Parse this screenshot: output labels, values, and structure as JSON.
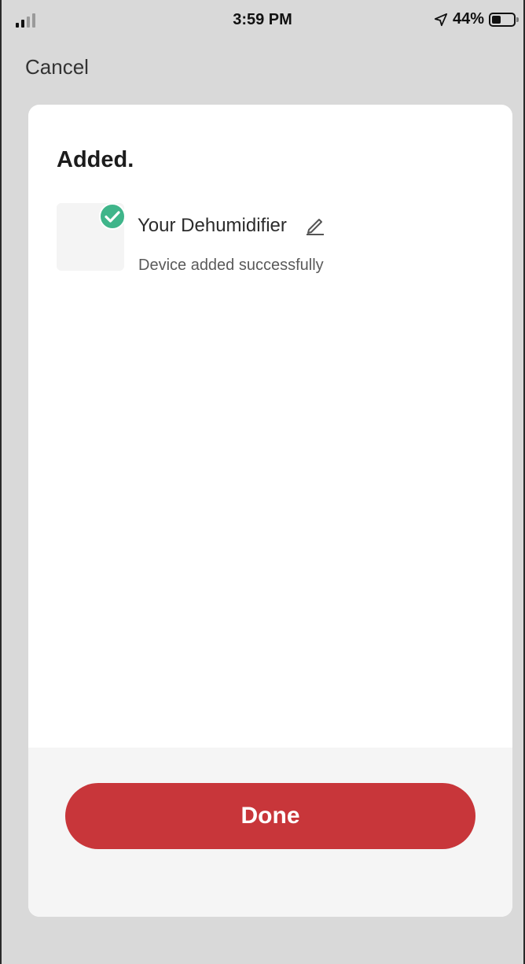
{
  "status_bar": {
    "time": "3:59 PM",
    "battery": "44%",
    "battery_level": 0.44,
    "icons": [
      "signal-icon",
      "location-arrow-icon",
      "battery-icon"
    ]
  },
  "nav": {
    "cancel_label": "Cancel"
  },
  "card": {
    "title": "Added.",
    "device": {
      "name": "Your Dehumidifier",
      "status": "Device added successfully",
      "icons": [
        "check-circle-icon",
        "edit-pencil-icon"
      ]
    },
    "done_label": "Done"
  },
  "colors": {
    "accent_red": "#c8363a",
    "success_green": "#3fb58a",
    "background_gray": "#d9d9d9"
  }
}
